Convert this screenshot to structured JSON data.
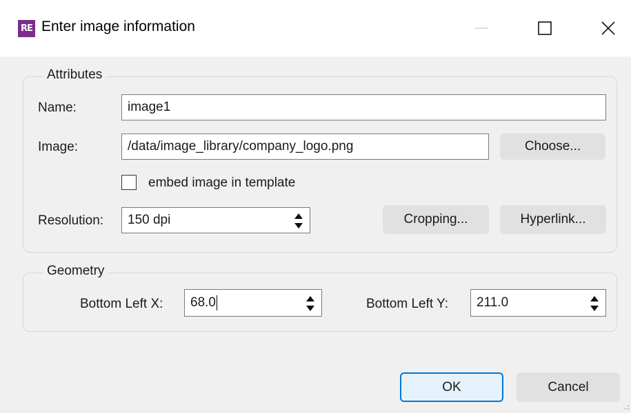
{
  "window": {
    "icon_text": "RE",
    "title": "Enter image information",
    "icons": {
      "minimize": "minimize-icon",
      "maximize": "maximize-icon",
      "close": "close-icon"
    }
  },
  "attributes": {
    "legend": "Attributes",
    "name_label": "Name:",
    "name_value": "image1",
    "image_label": "Image:",
    "image_value": "/data/image_library/company_logo.png",
    "choose_button": "Choose...",
    "embed_label": "embed image in template",
    "embed_checked": false,
    "resolution_label": "Resolution:",
    "resolution_value": "150 dpi",
    "cropping_button": "Cropping...",
    "hyperlink_button": "Hyperlink..."
  },
  "geometry": {
    "legend": "Geometry",
    "x_label": "Bottom Left X:",
    "x_value": "68.0",
    "y_label": "Bottom Left Y:",
    "y_value": "211.0"
  },
  "buttons": {
    "ok": "OK",
    "cancel": "Cancel"
  },
  "colors": {
    "accent": "#0078d7",
    "app_icon": "#7b2d8e"
  }
}
